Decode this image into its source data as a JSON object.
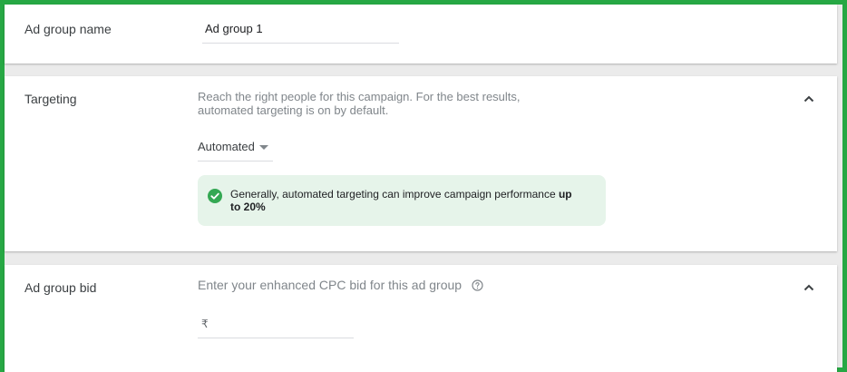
{
  "ad_group_name": {
    "label": "Ad group name",
    "value": "Ad group 1"
  },
  "targeting": {
    "label": "Targeting",
    "description": "Reach the right people for this campaign. For the best results, automated targeting is on by default.",
    "dropdown_value": "Automated",
    "notice_text": "Generally, automated targeting can improve campaign performance ",
    "notice_bold": "up to 20%",
    "collapse_icon": "chevron-up-icon"
  },
  "ad_group_bid": {
    "label": "Ad group bid",
    "description": "Enter your enhanced CPC bid for this ad group",
    "help_icon": "help-circle-icon",
    "currency_symbol": "₹",
    "collapse_icon": "chevron-up-icon"
  },
  "colors": {
    "frame_border": "#27a844",
    "notice_background": "#e6f4ea",
    "check_icon": "#34a853"
  }
}
